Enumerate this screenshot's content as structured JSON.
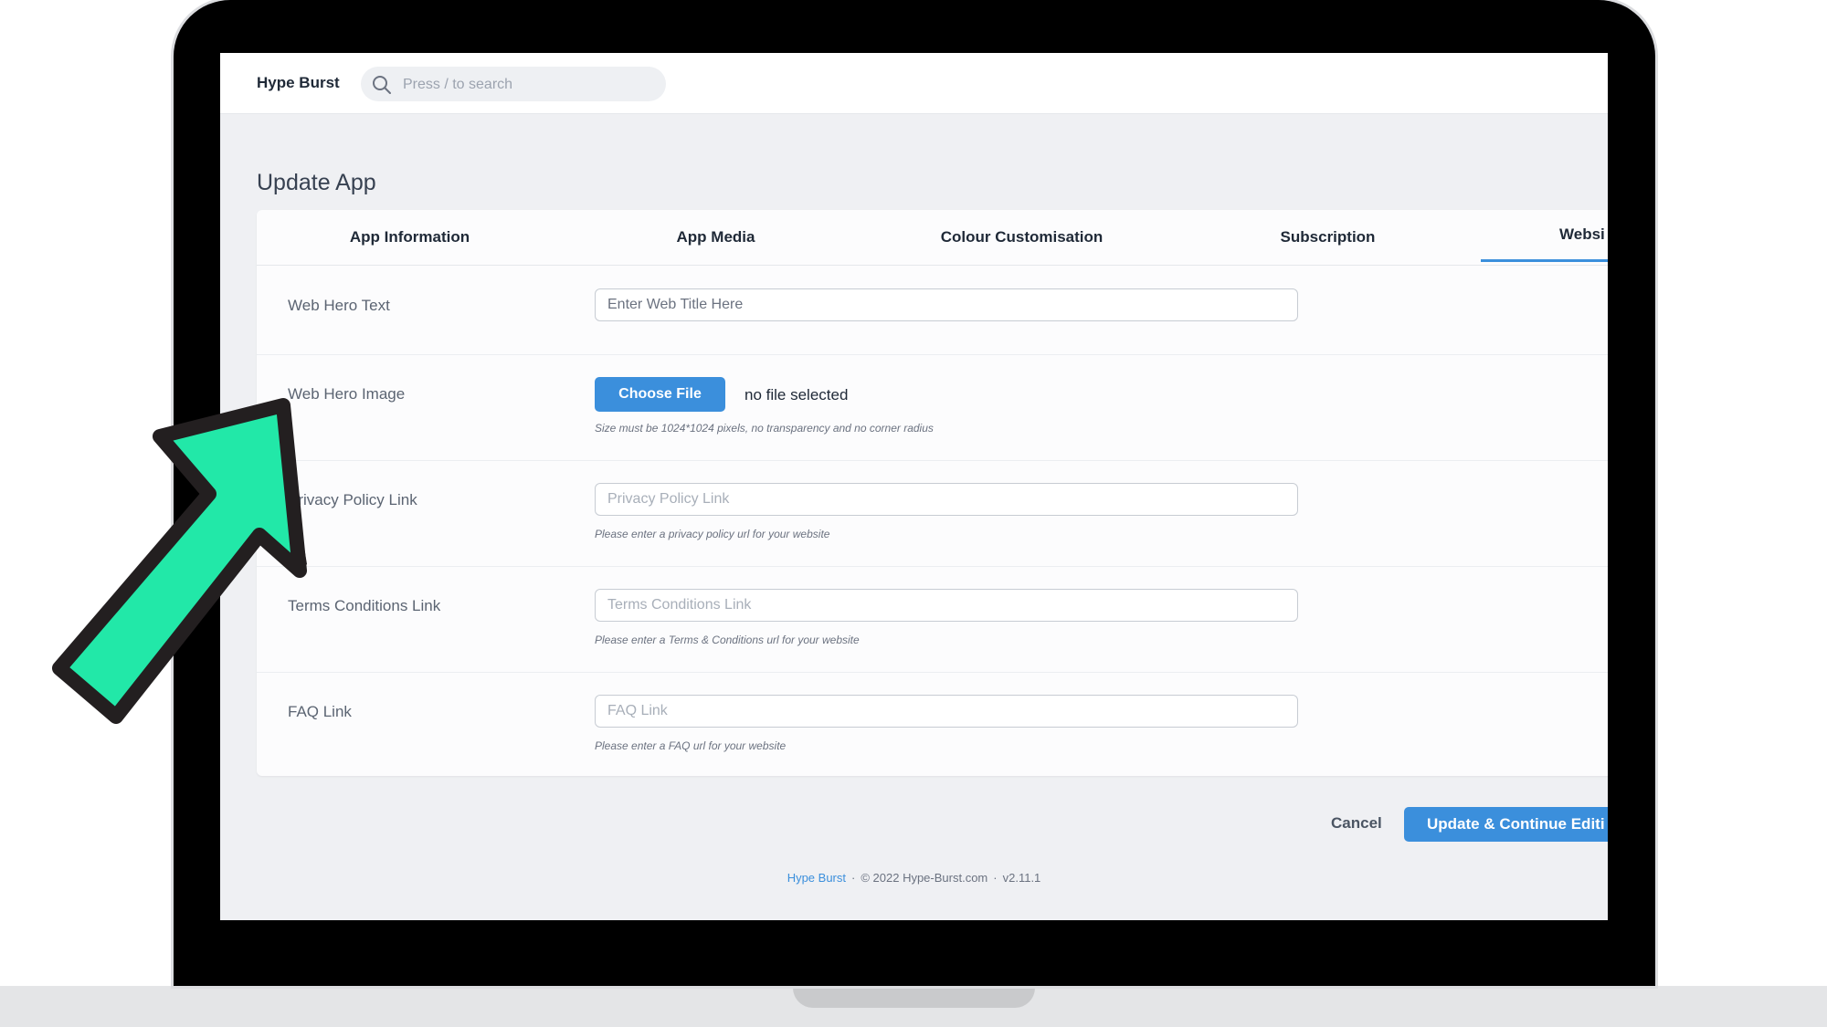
{
  "app": {
    "brand": "Hype Burst",
    "search_placeholder": "Press / to search"
  },
  "page": {
    "title": "Update App"
  },
  "tabs": [
    {
      "label": "App Information"
    },
    {
      "label": "App Media"
    },
    {
      "label": "Colour Customisation"
    },
    {
      "label": "Subscription"
    },
    {
      "label": "Websi",
      "active": true
    }
  ],
  "form": {
    "web_hero_text": {
      "label": "Web Hero Text",
      "placeholder": "Enter Web Title Here",
      "value": ""
    },
    "web_hero_image": {
      "label": "Web Hero Image",
      "button": "Choose File",
      "status": "no file selected",
      "hint": "Size must be 1024*1024 pixels, no transparency and no corner radius"
    },
    "privacy_policy": {
      "label": "Privacy Policy Link",
      "placeholder": "Privacy Policy Link",
      "hint": "Please enter a privacy policy url for your website"
    },
    "terms_conditions": {
      "label": "Terms Conditions Link",
      "placeholder": "Terms Conditions Link",
      "hint": "Please enter a Terms & Conditions url for your website"
    },
    "faq": {
      "label": "FAQ Link",
      "placeholder": "FAQ Link",
      "hint": "Please enter a FAQ url for your website"
    }
  },
  "actions": {
    "cancel": "Cancel",
    "update": "Update & Continue Editi"
  },
  "footer": {
    "brand_link": "Hype Burst",
    "separator": "·",
    "copyright": "© 2022 Hype-Burst.com",
    "version": "v2.11.1"
  },
  "colors": {
    "accent": "#3b8fdc",
    "arrow_fill": "#22e8a8",
    "arrow_outline": "#231f20"
  },
  "icons": [
    "search-icon",
    "arrow-pointer-icon"
  ]
}
